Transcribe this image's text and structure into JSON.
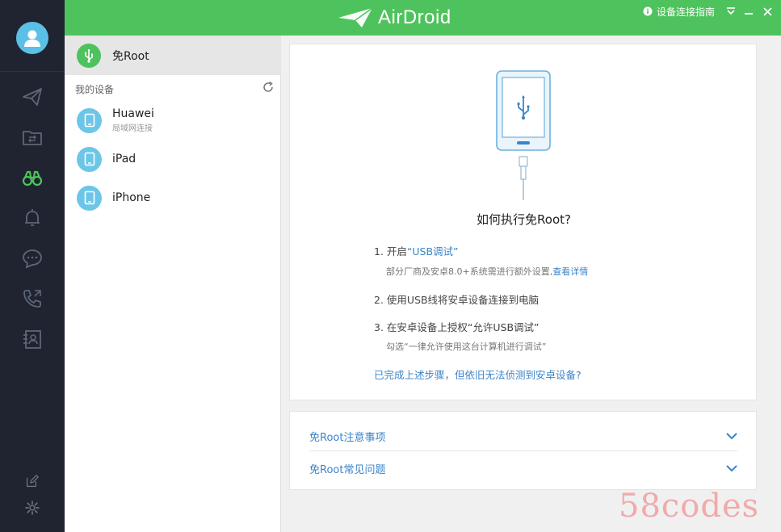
{
  "app": {
    "logo_text": "AirDroid",
    "guide_label": "设备连接指南"
  },
  "sidebar_rail": {
    "items": [
      {
        "icon": "send-icon"
      },
      {
        "icon": "file-transfer-icon"
      },
      {
        "icon": "binoculars-icon",
        "active": true
      },
      {
        "icon": "notification-bell-icon"
      },
      {
        "icon": "chat-icon"
      },
      {
        "icon": "phone-call-icon"
      },
      {
        "icon": "contacts-icon"
      }
    ],
    "bottom": [
      {
        "icon": "edit-icon"
      },
      {
        "icon": "gear-icon"
      }
    ]
  },
  "devices": {
    "root_label": "免Root",
    "section_title": "我的设备",
    "list": [
      {
        "name": "Huawei",
        "sub": "局域网连接"
      },
      {
        "name": "iPad",
        "sub": ""
      },
      {
        "name": "iPhone",
        "sub": ""
      }
    ]
  },
  "guide": {
    "title": "如何执行免Root?",
    "step1_prefix": "1. 开启",
    "step1_highlight": "“USB调试”",
    "step1_note": "部分厂商及安卓8.0+系统需进行额外设置,",
    "step1_link": "查看详情",
    "step2": "2. 使用USB线将安卓设备连接到电脑",
    "step3": "3. 在安卓设备上授权“允许USB调试”",
    "step3_note": "勾选“一律允许使用这台计算机进行调试”",
    "help_link": "已完成上述步骤，但依旧无法侦测到安卓设备?"
  },
  "faq": {
    "items": [
      {
        "label": "免Root注意事项"
      },
      {
        "label": "免Root常见问题"
      }
    ]
  },
  "watermark": "58codes",
  "colors": {
    "brand_green": "#4ec35d",
    "rail_dark": "#1f2430",
    "link_blue": "#3b84c9",
    "device_blue": "#6cc6e8"
  }
}
